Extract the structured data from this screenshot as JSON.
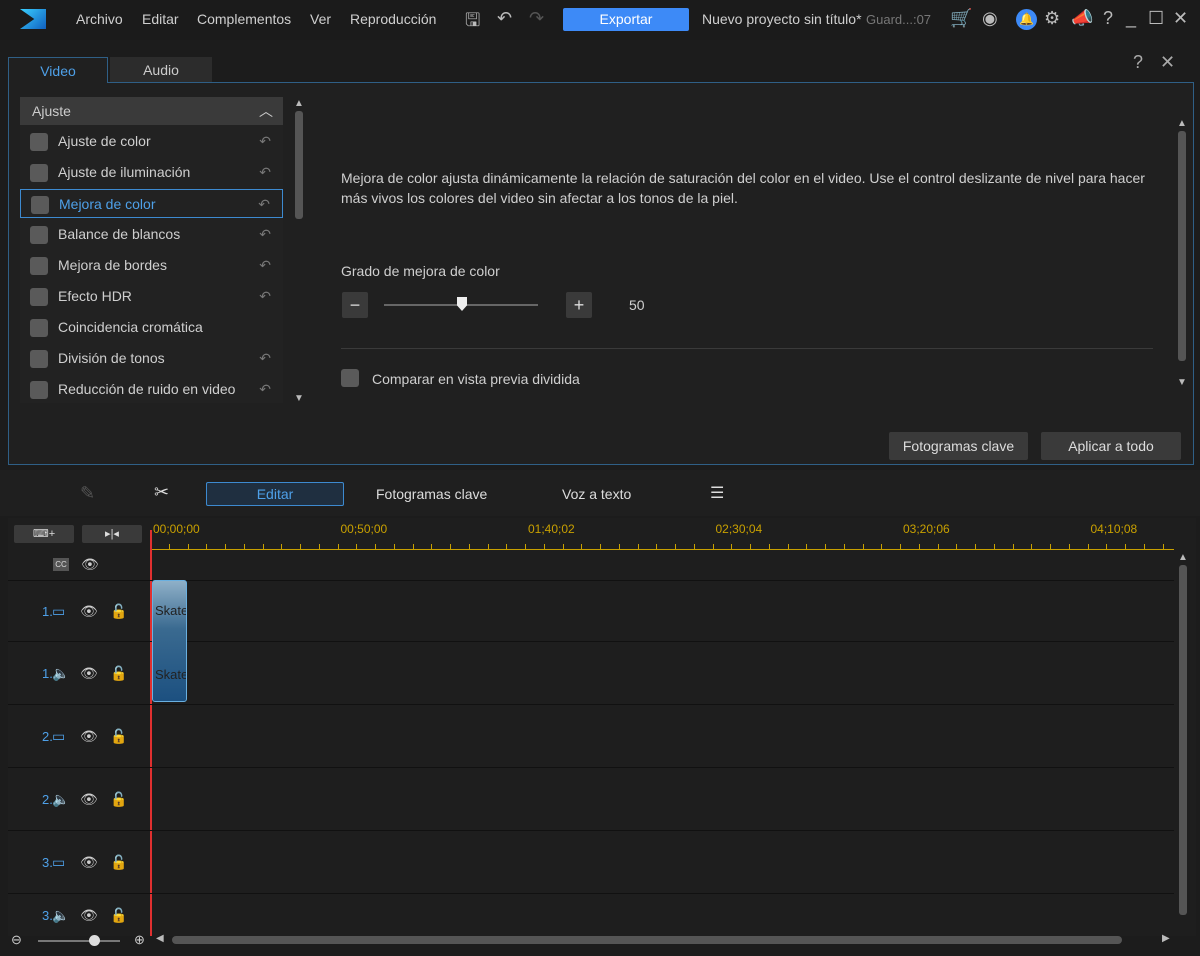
{
  "titlebar": {
    "menu": [
      "Archivo",
      "Editar",
      "Complementos",
      "Ver",
      "Reproducción"
    ],
    "export_label": "Exportar",
    "project": "Nuevo proyecto sin título*",
    "saved": "Guard...:07"
  },
  "panel": {
    "tabs": [
      "Video",
      "Audio"
    ],
    "active_tab": "Video",
    "help": "?",
    "close": "✕",
    "section": "Ajuste",
    "items": [
      {
        "label": "Ajuste de color",
        "reset": true
      },
      {
        "label": "Ajuste de iluminación",
        "reset": true
      },
      {
        "label": "Mejora de color",
        "reset": true,
        "selected": true
      },
      {
        "label": "Balance de blancos",
        "reset": true
      },
      {
        "label": "Mejora de bordes",
        "reset": true
      },
      {
        "label": "Efecto HDR",
        "reset": true
      },
      {
        "label": "Coincidencia cromática",
        "reset": false
      },
      {
        "label": "División de tonos",
        "reset": true
      },
      {
        "label": "Reducción de ruido en video",
        "reset": true
      }
    ],
    "description": "Mejora de color ajusta dinámicamente la relación de saturación del color en el video. Use el control deslizante de nivel para hacer más vivos los colores del video sin afectar a los tonos de la piel.",
    "slider_label": "Grado de mejora de color",
    "slider_value": "50",
    "slider_fraction": 0.5,
    "compare_label": "Comparar en vista previa dividida",
    "keyframes_btn": "Fotogramas clave",
    "apply_all_btn": "Aplicar a todo"
  },
  "toolbar": {
    "edit": "Editar",
    "keyframes": "Fotogramas clave",
    "voice": "Voz a texto"
  },
  "timeline": {
    "ticks": [
      "00;00;00",
      "00;50;00",
      "01;40;02",
      "02;30;04",
      "03;20;06",
      "04;10;08"
    ],
    "tracks": [
      {
        "num": "1.",
        "type": "video"
      },
      {
        "num": "1.",
        "type": "audio"
      },
      {
        "num": "2.",
        "type": "video"
      },
      {
        "num": "2.",
        "type": "audio"
      },
      {
        "num": "3.",
        "type": "video"
      },
      {
        "num": "3.",
        "type": "audio"
      }
    ],
    "clip_label": "Skate"
  },
  "colors": {
    "accent": "#3d8af7",
    "timecode": "#c8a000",
    "playhead": "#e03030"
  }
}
